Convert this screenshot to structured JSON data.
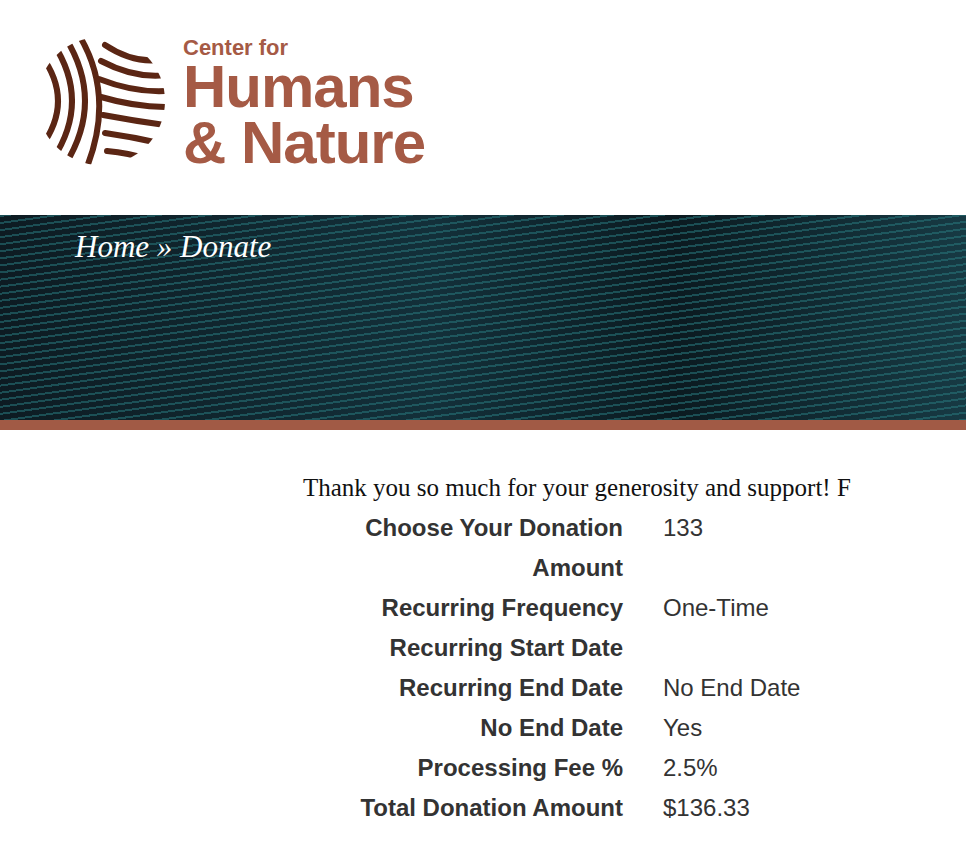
{
  "logo": {
    "line1": "Center for",
    "line2": "Humans",
    "line3": "& Nature"
  },
  "breadcrumb": {
    "items": [
      "Home",
      "Donate"
    ],
    "separator": "»"
  },
  "message": "Thank you so much for your generosity and support! F",
  "fields": [
    {
      "label": "Choose Your Donation Amount",
      "value": "133"
    },
    {
      "label": "Recurring Frequency",
      "value": "One-Time"
    },
    {
      "label": "Recurring Start Date",
      "value": ""
    },
    {
      "label": "Recurring End Date",
      "value": "No End Date"
    },
    {
      "label": "No End Date",
      "value": "Yes"
    },
    {
      "label": "Processing Fee %",
      "value": "2.5%"
    },
    {
      "label": "Total Donation Amount",
      "value": "$136.33"
    }
  ]
}
